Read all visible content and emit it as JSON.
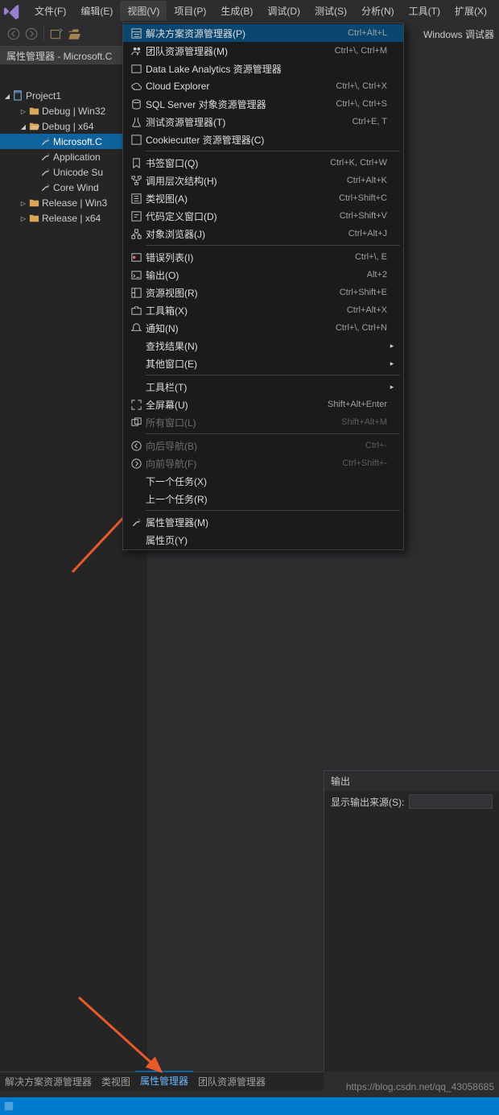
{
  "menubar": {
    "items": [
      "文件(F)",
      "编辑(E)",
      "视图(V)",
      "项目(P)",
      "生成(B)",
      "调试(D)",
      "测试(S)",
      "分析(N)",
      "工具(T)",
      "扩展(X)"
    ],
    "activeIndex": 2
  },
  "toolbar": {
    "rightText": "Windows 调试器"
  },
  "sidebar": {
    "title": "属性管理器 - Microsoft.C",
    "tree": {
      "project": "Project1",
      "items": [
        {
          "label": "Debug | Win32",
          "kind": "folder",
          "expand": "right",
          "depth": 1
        },
        {
          "label": "Debug | x64",
          "kind": "folder-open",
          "expand": "down",
          "depth": 1
        },
        {
          "label": "Microsoft.C",
          "kind": "wrench",
          "selected": true,
          "depth": 2
        },
        {
          "label": "Application",
          "kind": "wrench",
          "depth": 2
        },
        {
          "label": "Unicode Su",
          "kind": "wrench",
          "depth": 2
        },
        {
          "label": "Core Wind",
          "kind": "wrench",
          "depth": 2
        },
        {
          "label": "Release | Win3",
          "kind": "folder",
          "expand": "right",
          "depth": 1
        },
        {
          "label": "Release | x64",
          "kind": "folder",
          "expand": "right",
          "depth": 1
        }
      ]
    }
  },
  "bottomTabs": {
    "items": [
      "解决方案资源管理器",
      "类视图",
      "属性管理器",
      "团队资源管理器"
    ],
    "activeIndex": 2
  },
  "dropdown": {
    "groups": [
      [
        {
          "icon": "window-list",
          "text": "解决方案资源管理器(P)",
          "short": "Ctrl+Alt+L",
          "highlight": true
        },
        {
          "icon": "team",
          "text": "团队资源管理器(M)",
          "short": "Ctrl+\\, Ctrl+M"
        },
        {
          "icon": "lake",
          "text": "Data Lake Analytics 资源管理器",
          "short": ""
        },
        {
          "icon": "cloud",
          "text": "Cloud Explorer",
          "short": "Ctrl+\\, Ctrl+X"
        },
        {
          "icon": "sql",
          "text": "SQL Server 对象资源管理器",
          "short": "Ctrl+\\, Ctrl+S"
        },
        {
          "icon": "test",
          "text": "测试资源管理器(T)",
          "short": "Ctrl+E, T"
        },
        {
          "icon": "cookie",
          "text": "Cookiecutter 资源管理器(C)",
          "short": ""
        }
      ],
      [
        {
          "icon": "bookmark",
          "text": "书签窗口(Q)",
          "short": "Ctrl+K, Ctrl+W"
        },
        {
          "icon": "hier",
          "text": "调用层次结构(H)",
          "short": "Ctrl+Alt+K"
        },
        {
          "icon": "class",
          "text": "类视图(A)",
          "short": "Ctrl+Shift+C"
        },
        {
          "icon": "def",
          "text": "代码定义窗口(D)",
          "short": "Ctrl+Shift+V"
        },
        {
          "icon": "obj",
          "text": "对象浏览器(J)",
          "short": "Ctrl+Alt+J"
        }
      ],
      [
        {
          "icon": "error",
          "text": "错误列表(I)",
          "short": "Ctrl+\\, E"
        },
        {
          "icon": "output",
          "text": "输出(O)",
          "short": "Alt+2"
        },
        {
          "icon": "resource",
          "text": "资源视图(R)",
          "short": "Ctrl+Shift+E"
        },
        {
          "icon": "toolbox",
          "text": "工具箱(X)",
          "short": "Ctrl+Alt+X"
        },
        {
          "icon": "notify",
          "text": "通知(N)",
          "short": "Ctrl+\\, Ctrl+N"
        },
        {
          "icon": "",
          "text": "查找结果(N)",
          "short": "",
          "sub": true
        },
        {
          "icon": "",
          "text": "其他窗口(E)",
          "short": "",
          "sub": true
        }
      ],
      [
        {
          "icon": "",
          "text": "工具栏(T)",
          "short": "",
          "sub": true
        },
        {
          "icon": "full",
          "text": "全屏幕(U)",
          "short": "Shift+Alt+Enter"
        },
        {
          "icon": "all",
          "text": "所有窗口(L)",
          "short": "Shift+Alt+M",
          "disabled": true
        }
      ],
      [
        {
          "icon": "navb",
          "text": "向后导航(B)",
          "short": "Ctrl+-",
          "disabled": true
        },
        {
          "icon": "navf",
          "text": "向前导航(F)",
          "short": "Ctrl+Shift+-",
          "disabled": true
        },
        {
          "icon": "",
          "text": "下一个任务(X)",
          "short": ""
        },
        {
          "icon": "",
          "text": "上一个任务(R)",
          "short": ""
        }
      ],
      [
        {
          "icon": "wrench",
          "text": "属性管理器(M)",
          "short": ""
        },
        {
          "icon": "",
          "text": "属性页(Y)",
          "short": ""
        }
      ]
    ]
  },
  "output": {
    "title": "输出",
    "sourceLabel": "显示输出来源(S):"
  },
  "watermark": "https://blog.csdn.net/qq_43058685"
}
